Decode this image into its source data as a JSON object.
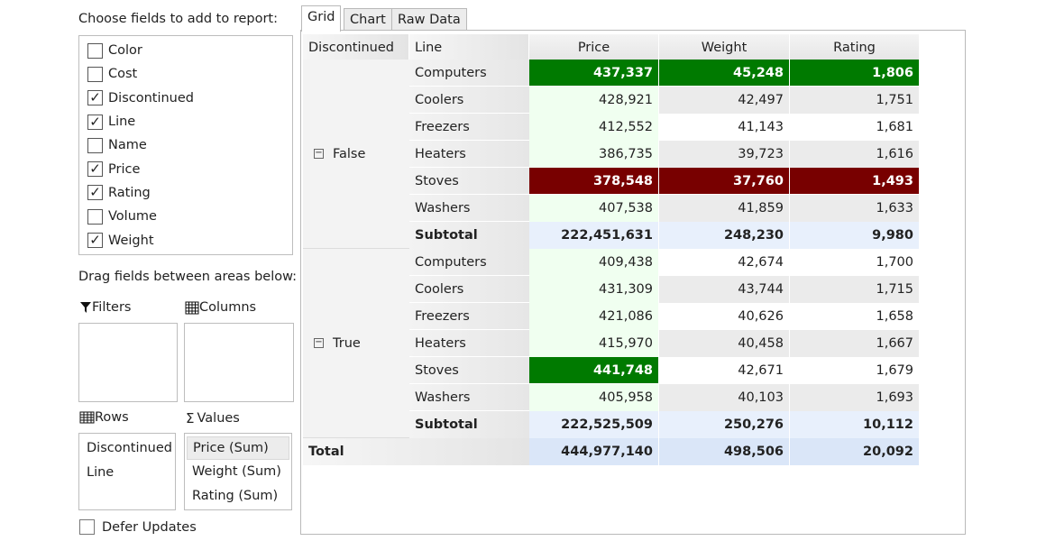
{
  "left": {
    "choose_label": "Choose fields to add to report:",
    "fields": [
      {
        "label": "Color",
        "checked": false
      },
      {
        "label": "Cost",
        "checked": false
      },
      {
        "label": "Discontinued",
        "checked": true
      },
      {
        "label": "Line",
        "checked": true
      },
      {
        "label": "Name",
        "checked": false
      },
      {
        "label": "Price",
        "checked": true
      },
      {
        "label": "Rating",
        "checked": true
      },
      {
        "label": "Volume",
        "checked": false
      },
      {
        "label": "Weight",
        "checked": true
      }
    ],
    "drag_label": "Drag fields between areas below:",
    "filters_label": "Filters",
    "columns_label": "Columns",
    "rows_label": "Rows",
    "values_label": "Values",
    "rows_items": [
      "Discontinued",
      "Line"
    ],
    "values_items": [
      "Price (Sum)",
      "Weight (Sum)",
      "Rating (Sum)"
    ],
    "defer_label": "Defer Updates",
    "defer_checked": false,
    "icons": {
      "filters": "filter-icon",
      "columns": "grid-columns-icon",
      "rows": "grid-rows-icon",
      "values": "sigma-icon"
    }
  },
  "tabs": [
    "Grid",
    "Chart",
    "Raw Data"
  ],
  "active_tab": "Grid",
  "grid": {
    "headers": [
      "Discontinued",
      "Line",
      "Price",
      "Weight",
      "Rating"
    ],
    "colors": {
      "high": "#007a00",
      "low": "#780000",
      "price_bg": "#f0fff0",
      "alt_bg": "#ebebeb",
      "subtotal_bg": "#e8f0fc",
      "total_bg": "#dae6f8"
    },
    "groups": [
      {
        "label": "False",
        "collapse_icon": "minus-box-icon",
        "rows": [
          {
            "line": "Computers",
            "price": "437,337",
            "weight": "45,248",
            "rating": "1,806",
            "hl": [
              "high",
              "high",
              "high"
            ]
          },
          {
            "line": "Coolers",
            "price": "428,921",
            "weight": "42,497",
            "rating": "1,751",
            "hl": [
              null,
              null,
              null
            ]
          },
          {
            "line": "Freezers",
            "price": "412,552",
            "weight": "41,143",
            "rating": "1,681",
            "hl": [
              null,
              null,
              null
            ]
          },
          {
            "line": "Heaters",
            "price": "386,735",
            "weight": "39,723",
            "rating": "1,616",
            "hl": [
              null,
              null,
              null
            ]
          },
          {
            "line": "Stoves",
            "price": "378,548",
            "weight": "37,760",
            "rating": "1,493",
            "hl": [
              "low",
              "low",
              "low"
            ]
          },
          {
            "line": "Washers",
            "price": "407,538",
            "weight": "41,859",
            "rating": "1,633",
            "hl": [
              null,
              null,
              null
            ]
          }
        ],
        "subtotal": {
          "label": "Subtotal",
          "price": "222,451,631",
          "weight": "248,230",
          "rating": "9,980"
        }
      },
      {
        "label": "True",
        "collapse_icon": "minus-box-icon",
        "rows": [
          {
            "line": "Computers",
            "price": "409,438",
            "weight": "42,674",
            "rating": "1,700",
            "hl": [
              null,
              null,
              null
            ]
          },
          {
            "line": "Coolers",
            "price": "431,309",
            "weight": "43,744",
            "rating": "1,715",
            "hl": [
              null,
              null,
              null
            ]
          },
          {
            "line": "Freezers",
            "price": "421,086",
            "weight": "40,626",
            "rating": "1,658",
            "hl": [
              null,
              null,
              null
            ]
          },
          {
            "line": "Heaters",
            "price": "415,970",
            "weight": "40,458",
            "rating": "1,667",
            "hl": [
              null,
              null,
              null
            ]
          },
          {
            "line": "Stoves",
            "price": "441,748",
            "weight": "42,671",
            "rating": "1,679",
            "hl": [
              "high",
              null,
              null
            ]
          },
          {
            "line": "Washers",
            "price": "405,958",
            "weight": "40,103",
            "rating": "1,693",
            "hl": [
              null,
              null,
              null
            ]
          }
        ],
        "subtotal": {
          "label": "Subtotal",
          "price": "222,525,509",
          "weight": "250,276",
          "rating": "10,112"
        }
      }
    ],
    "total": {
      "label": "Total",
      "price": "444,977,140",
      "weight": "498,506",
      "rating": "20,092"
    }
  }
}
